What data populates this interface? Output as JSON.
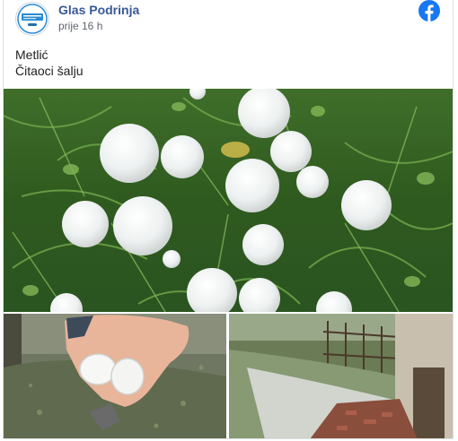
{
  "post": {
    "page_name": "Glas Podrinja",
    "timestamp": "prije 16 h",
    "text_lines": [
      "Metlić",
      "Čitaoci šalju"
    ]
  },
  "avatar": {
    "logo_text": "GLAS PODRINJA",
    "sub_text": "ONLINE"
  },
  "icons": {
    "platform": "facebook-icon"
  },
  "colors": {
    "page_name": "#385898",
    "facebook_blue": "#1877f2",
    "meta_text": "#606770"
  },
  "photos": [
    {
      "name": "hailstones-on-grass"
    },
    {
      "name": "hand-holding-hailstones"
    },
    {
      "name": "hail-covered-yard"
    }
  ]
}
